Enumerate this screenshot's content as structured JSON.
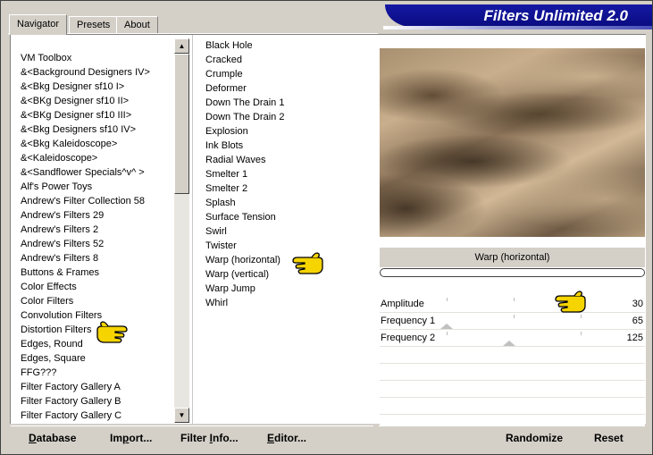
{
  "app": {
    "title": "Filters Unlimited 2.0"
  },
  "tabs": [
    {
      "label": "Navigator",
      "active": true
    },
    {
      "label": "Presets",
      "active": false
    },
    {
      "label": "About",
      "active": false
    }
  ],
  "categories": [
    "VM Toolbox",
    "&<Background Designers IV>",
    "&<Bkg Designer sf10 I>",
    "&<BKg Designer sf10 II>",
    "&<BKg Designer sf10 III>",
    "&<Bkg Designers sf10 IV>",
    "&<Bkg Kaleidoscope>",
    "&<Kaleidoscope>",
    "&<Sandflower Specials^v^ >",
    "Alf's Power Toys",
    "Andrew's Filter Collection 58",
    "Andrew's Filters 29",
    "Andrew's Filters 2",
    "Andrew's Filters 52",
    "Andrew's Filters 8",
    "Buttons & Frames",
    "Color Effects",
    "Color Filters",
    "Convolution Filters",
    "Distortion Filters",
    "Edges, Round",
    "Edges, Square",
    "FFG???",
    "Filter Factory Gallery A",
    "Filter Factory Gallery B",
    "Filter Factory Gallery C"
  ],
  "filters": [
    "Black Hole",
    "Cracked",
    "Crumple",
    "Deformer",
    "Down The Drain 1",
    "Down The Drain 2",
    "Explosion",
    "Ink Blots",
    "Radial Waves",
    "Smelter 1",
    "Smelter 2",
    "Splash",
    "Surface Tension",
    "Swirl",
    "Twister",
    "Warp (horizontal)",
    "Warp (vertical)",
    "Warp Jump",
    "Whirl"
  ],
  "selected": {
    "category": "Distortion Filters",
    "filter": "Warp (horizontal)"
  },
  "filter_name": "Warp (horizontal)",
  "params": [
    {
      "name": "Amplitude",
      "value": "30"
    },
    {
      "name": "Frequency 1",
      "value": "65"
    },
    {
      "name": "Frequency 2",
      "value": "125"
    }
  ],
  "buttons": {
    "database": {
      "accel": "D",
      "rest": "atabase"
    },
    "import": {
      "pre": "Im",
      "accel": "p",
      "rest": "ort..."
    },
    "filter_info": {
      "pre": "Filter ",
      "accel": "I",
      "rest": "nfo..."
    },
    "editor": {
      "accel": "E",
      "rest": "ditor..."
    },
    "randomize": "Randomize",
    "reset": "Reset"
  },
  "colors": {
    "banner": "#1518a4",
    "face": "#d4d0c8",
    "pointer": "#f5d400"
  },
  "icons": {
    "scroll_up": "triangle-up",
    "scroll_down": "triangle-down",
    "pointer": "pointing-hand"
  }
}
